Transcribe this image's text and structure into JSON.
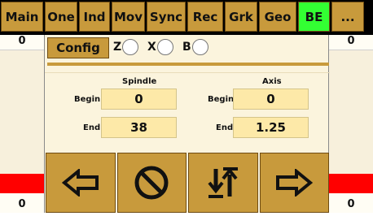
{
  "tabs": [
    {
      "label": "Main",
      "active": false
    },
    {
      "label": "One",
      "active": false
    },
    {
      "label": "Ind",
      "active": false
    },
    {
      "label": "Mov",
      "active": false
    },
    {
      "label": "Sync",
      "active": false
    },
    {
      "label": "Rec",
      "active": false
    },
    {
      "label": "Grk",
      "active": false
    },
    {
      "label": "Geo",
      "active": false
    },
    {
      "label": "BE",
      "active": true
    },
    {
      "label": "...",
      "active": false
    }
  ],
  "left_side": {
    "top_value": "0",
    "bottom_value": "0"
  },
  "right_side": {
    "top_value": "0",
    "bottom_value": "0"
  },
  "panel": {
    "config_label": "Config",
    "axis_select": [
      {
        "letter": "Z",
        "selected": false
      },
      {
        "letter": "X",
        "selected": false
      },
      {
        "letter": "B",
        "selected": false
      }
    ],
    "spindle": {
      "title": "Spindle",
      "begin_label": "Begin",
      "begin_value": "0",
      "end_label": "End",
      "end_value": "38"
    },
    "axis": {
      "title": "Axis",
      "begin_label": "Begin",
      "begin_value": "0",
      "end_label": "End",
      "end_value": "1.25"
    }
  },
  "actions": [
    {
      "icon": "arrow-left-icon"
    },
    {
      "icon": "prohibited-icon"
    },
    {
      "icon": "sort-arrows-icon"
    },
    {
      "icon": "arrow-right-icon"
    }
  ],
  "colors": {
    "tab": "#c89a3c",
    "tab_active": "#33ff33",
    "panel": "#fbf4dd",
    "field": "#fde9a8",
    "alert": "#ff0000"
  }
}
